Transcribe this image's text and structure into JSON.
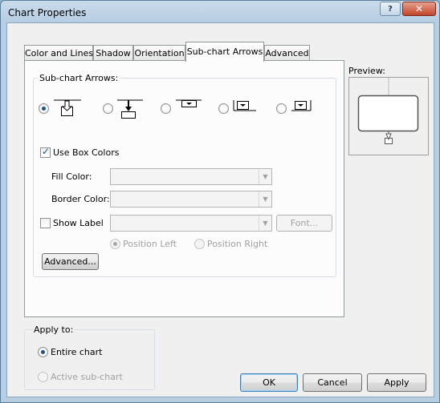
{
  "window": {
    "title": "Chart Properties"
  },
  "titlebar": {
    "help_glyph": "?",
    "close_glyph": "✕"
  },
  "tabs": [
    {
      "label": "Color and Lines",
      "active": false
    },
    {
      "label": "Shadow",
      "active": false
    },
    {
      "label": "Orientation",
      "active": false
    },
    {
      "label": "Sub-chart Arrows",
      "active": true
    },
    {
      "label": "Advanced",
      "active": false
    }
  ],
  "subchart_arrows": {
    "group_label": "Sub-chart Arrows:",
    "styles": [
      {
        "icon": "arrow-style-1-icon",
        "selected": true
      },
      {
        "icon": "arrow-style-2-icon",
        "selected": false
      },
      {
        "icon": "arrow-style-3-icon",
        "selected": false
      },
      {
        "icon": "arrow-style-4-icon",
        "selected": false
      },
      {
        "icon": "arrow-style-5-icon",
        "selected": false
      }
    ],
    "use_box_colors": {
      "label": "Use Box Colors",
      "checked": true
    },
    "fill_color": {
      "label": "Fill Color:",
      "value": ""
    },
    "border_color": {
      "label": "Border Color:",
      "value": ""
    },
    "show_label": {
      "label": "Show Label",
      "checked": false,
      "value": ""
    },
    "font_button": "Font...",
    "position_left": {
      "label": "Position Left",
      "selected": true,
      "enabled": false
    },
    "position_right": {
      "label": "Position Right",
      "selected": false,
      "enabled": false
    },
    "advanced_button": "Advanced..."
  },
  "preview": {
    "label": "Preview:"
  },
  "apply_to": {
    "label": "Apply to:",
    "entire_chart": {
      "label": "Entire chart",
      "selected": true
    },
    "active_subchart": {
      "label": "Active sub-chart",
      "selected": false,
      "enabled": false
    }
  },
  "buttons": {
    "ok": "OK",
    "cancel": "Cancel",
    "apply": "Apply"
  }
}
